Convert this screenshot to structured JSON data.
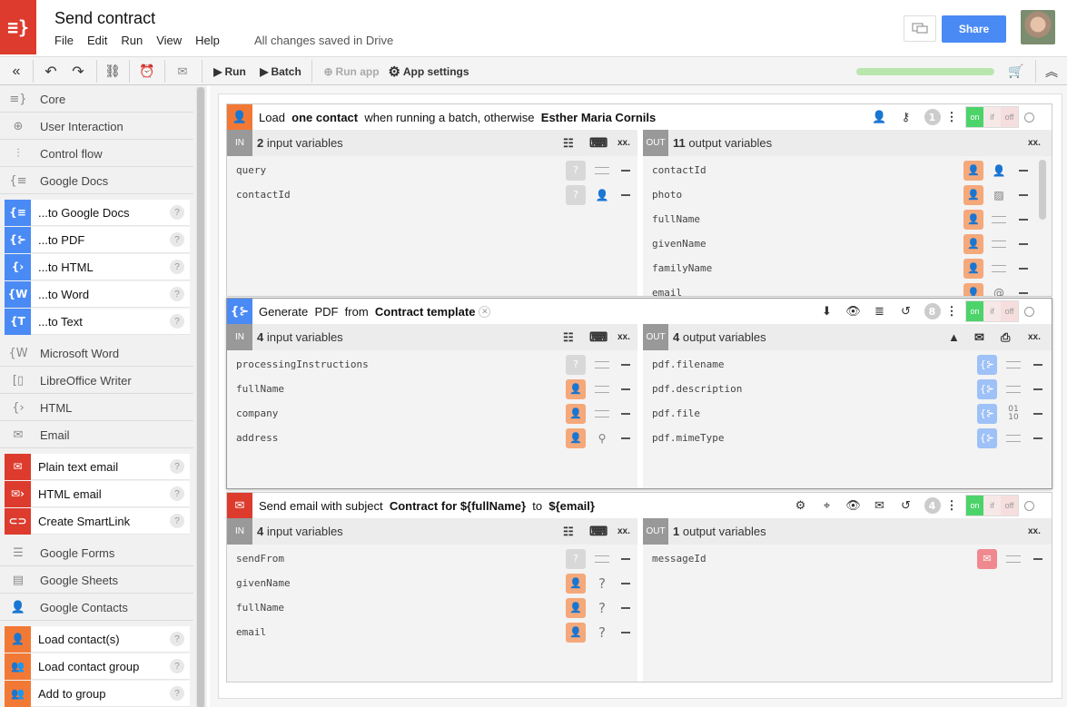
{
  "app": {
    "title": "Send contract",
    "saved_status": "All changes saved in Drive",
    "share_label": "Share",
    "menu": [
      "File",
      "Edit",
      "Run",
      "View",
      "Help"
    ]
  },
  "toolbar": {
    "run_label": "Run",
    "batch_label": "Batch",
    "run_app_label": "Run app",
    "app_settings_label": "App settings",
    "progress": 1.0
  },
  "sidebar": {
    "categories": {
      "core": "Core",
      "user_interaction": "User Interaction",
      "control_flow": "Control flow",
      "google_docs": "Google Docs",
      "microsoft_word": "Microsoft Word",
      "libreoffice_writer": "LibreOffice Writer",
      "html": "HTML",
      "email": "Email",
      "google_forms": "Google Forms",
      "google_sheets": "Google Sheets",
      "google_contacts": "Google Contacts"
    },
    "docs_items": [
      "...to Google Docs",
      "...to PDF",
      "...to HTML",
      "...to Word",
      "...to Text"
    ],
    "email_items": [
      "Plain text email",
      "HTML email",
      "Create SmartLink"
    ],
    "contacts_items": [
      "Load contact(s)",
      "Load contact group",
      "Add to group"
    ],
    "help": "?"
  },
  "steps": [
    {
      "t1": "Load",
      "t2": "one contact",
      "t3": "when running a batch, otherwise",
      "t4": "Esther Maria Cornils",
      "badge": "1",
      "in_tag": "IN",
      "in_count": "2",
      "in_label": "input variables",
      "out_tag": "OUT",
      "out_count": "11",
      "out_label": "output variables",
      "inputs": [
        "query",
        "contactId"
      ],
      "outputs": [
        "contactId",
        "photo",
        "fullName",
        "givenName",
        "familyName",
        "email"
      ]
    },
    {
      "t1": "Generate",
      "t2": "PDF",
      "t3": "from",
      "t4": "Contract template",
      "badge": "8",
      "in_tag": "IN",
      "in_count": "4",
      "in_label": "input variables",
      "out_tag": "OUT",
      "out_count": "4",
      "out_label": "output variables",
      "inputs": [
        "processingInstructions",
        "fullName",
        "company",
        "address"
      ],
      "outputs": [
        "pdf.filename",
        "pdf.description",
        "pdf.file",
        "pdf.mimeType"
      ]
    },
    {
      "t1": "Send email with subject",
      "t2": "Contract for ${fullName}",
      "t3": "to",
      "t4": "${email}",
      "badge": "4",
      "in_tag": "IN",
      "in_count": "4",
      "in_label": "input variables",
      "out_tag": "OUT",
      "out_count": "1",
      "out_label": "output variables",
      "inputs": [
        "sendFrom",
        "givenName",
        "fullName",
        "email"
      ],
      "outputs": [
        "messageId"
      ]
    }
  ],
  "toggle": {
    "on": "on",
    "if": "if",
    "off": "off"
  },
  "misc": {
    "binary": "01\n10",
    "qmark": "?",
    "xx": "xx."
  }
}
